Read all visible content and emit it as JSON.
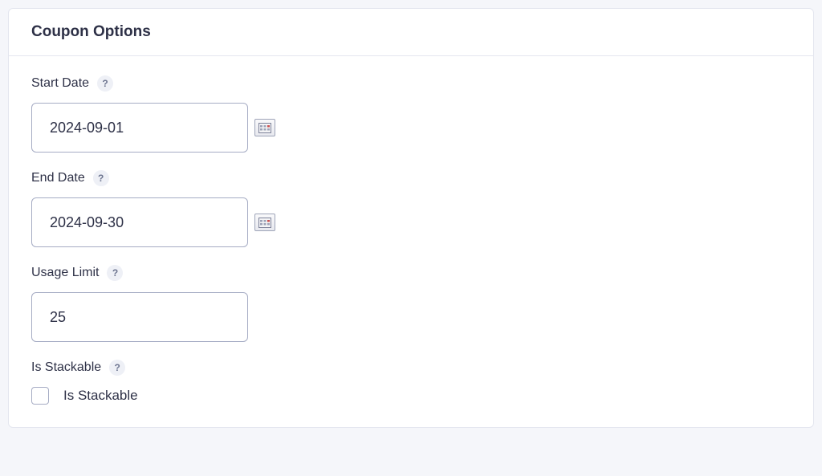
{
  "panel": {
    "title": "Coupon Options"
  },
  "fields": {
    "start_date": {
      "label": "Start Date",
      "value": "2024-09-01",
      "help": "?"
    },
    "end_date": {
      "label": "End Date",
      "value": "2024-09-30",
      "help": "?"
    },
    "usage_limit": {
      "label": "Usage Limit",
      "value": "25",
      "help": "?"
    },
    "is_stackable": {
      "label": "Is Stackable",
      "checkbox_label": "Is Stackable",
      "checked": false,
      "help": "?"
    }
  }
}
